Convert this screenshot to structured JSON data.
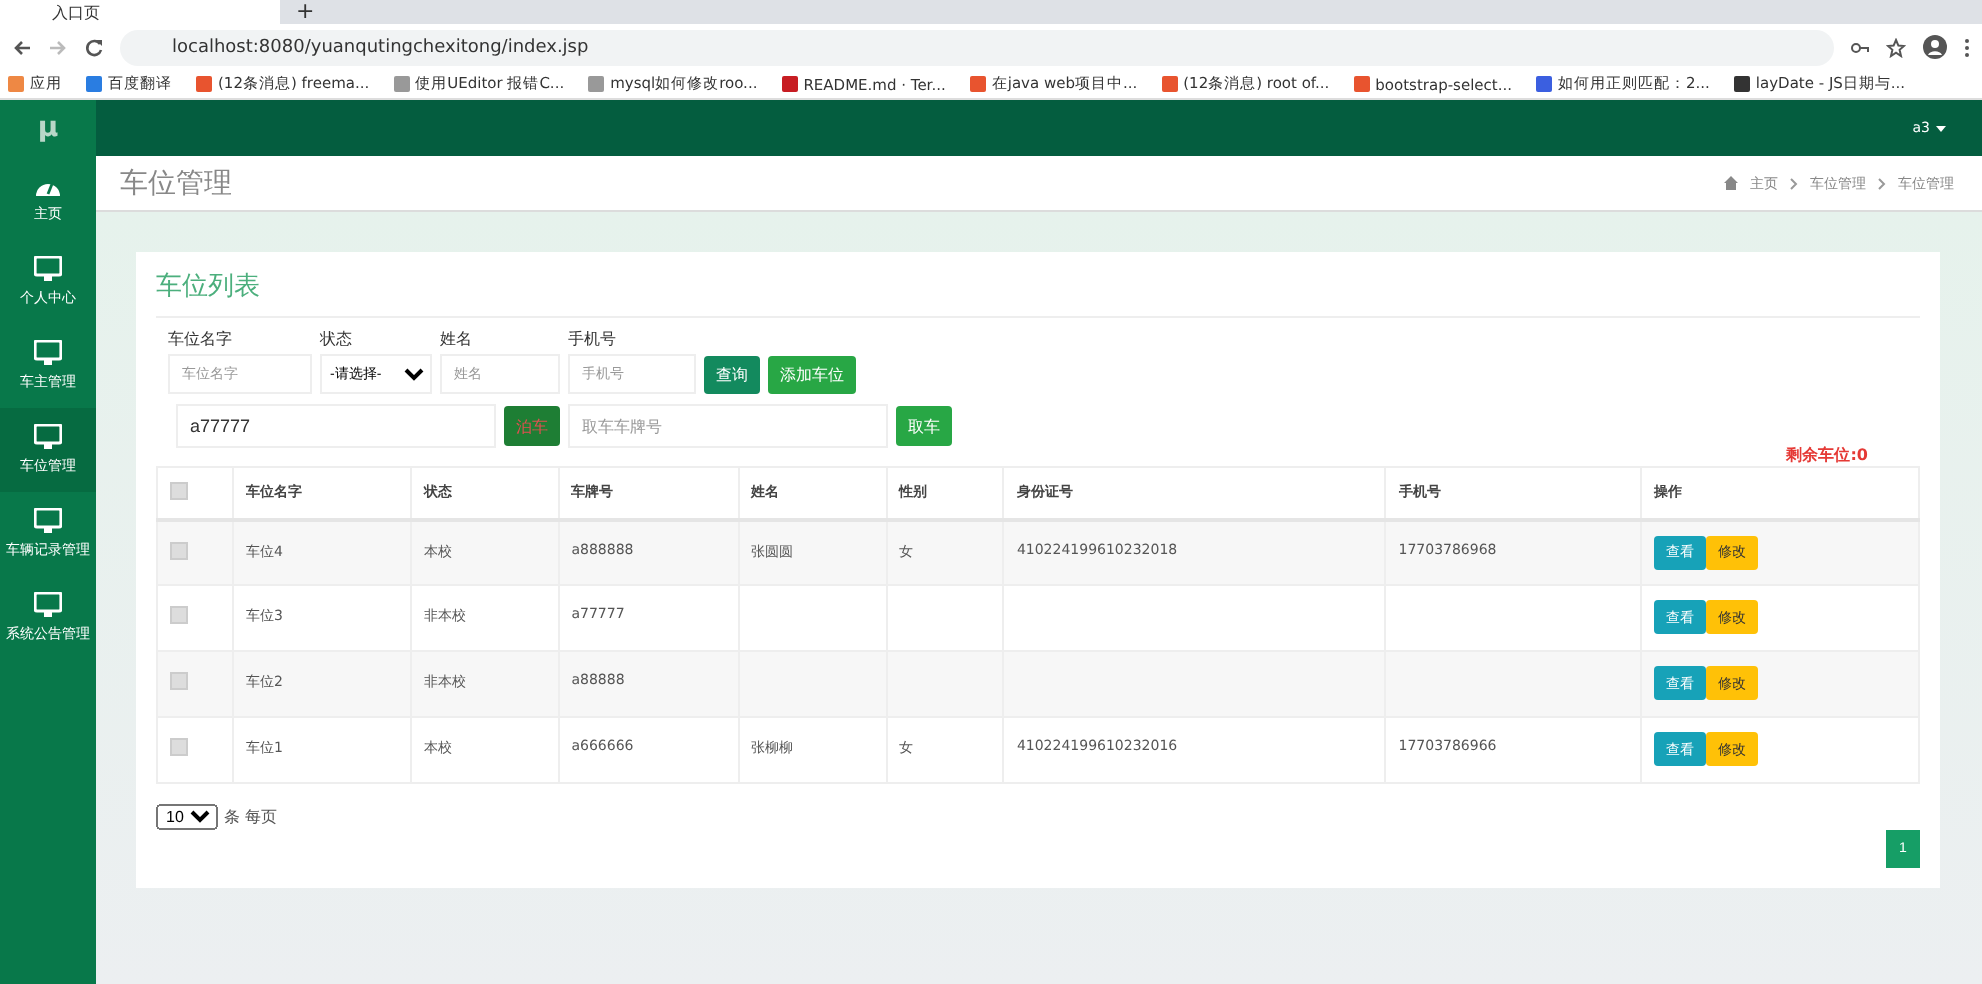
{
  "browser": {
    "tab_title": "入口页",
    "new_tab": "+",
    "url": "localhost:8080/yuanqutingchexitong/index.jsp",
    "bookmarks": [
      {
        "label": "应用",
        "kind": "apps"
      },
      {
        "label": "百度翻译",
        "kind": "blue"
      },
      {
        "label": "(12条消息) freema...",
        "kind": "csdn"
      },
      {
        "label": "使用UEditor 报错C...",
        "kind": "paw"
      },
      {
        "label": "mysql如何修改roo...",
        "kind": "paw"
      },
      {
        "label": "README.md · Ter...",
        "kind": "gitee"
      },
      {
        "label": "在java web项目中...",
        "kind": "csdn"
      },
      {
        "label": "(12条消息) root of...",
        "kind": "csdn"
      },
      {
        "label": "bootstrap-select...",
        "kind": "csdn"
      },
      {
        "label": "如何用正则匹配：2...",
        "kind": "baidu"
      },
      {
        "label": "layDate - JS日期与...",
        "kind": "dark"
      }
    ]
  },
  "app": {
    "logo": "µ",
    "user": "a3",
    "sidebar": [
      {
        "label": "主页",
        "kind": "dashboard",
        "selected": false
      },
      {
        "label": "个人中心",
        "kind": "monitor",
        "selected": false
      },
      {
        "label": "车主管理",
        "kind": "monitor",
        "selected": false
      },
      {
        "label": "车位管理",
        "kind": "monitor",
        "selected": true
      },
      {
        "label": "车辆记录管理",
        "kind": "monitor",
        "selected": false
      },
      {
        "label": "系统公告管理",
        "kind": "monitor",
        "selected": false
      }
    ],
    "page_title": "车位管理",
    "breadcrumb": [
      "主页",
      "车位管理",
      "车位管理"
    ]
  },
  "card": {
    "title": "车位列表",
    "filters": [
      {
        "label": "车位名字",
        "kind": "input",
        "placeholder": "车位名字"
      },
      {
        "label": "状态",
        "kind": "select",
        "value": "-请选择-"
      },
      {
        "label": "姓名",
        "kind": "input",
        "placeholder": "姓名"
      },
      {
        "label": "手机号",
        "kind": "input",
        "placeholder": "手机号"
      }
    ],
    "query_button": "查询",
    "add_button": "添加车位",
    "park_field": {
      "value": "a77777"
    },
    "park_button": "泊车",
    "pickup_field": {
      "placeholder": "取车车牌号"
    },
    "pickup_button": "取车",
    "remaining": "剩余车位:0",
    "table": {
      "header_checked": false,
      "columns": [
        "车位名字",
        "状态",
        "车牌号",
        "姓名",
        "性别",
        "身份证号",
        "手机号",
        "操作"
      ],
      "rows": [
        {
          "checked": false,
          "cells": [
            "车位4",
            "本校",
            "a888888",
            "张圆圆",
            "女",
            "410224199610232018",
            "17703786968"
          ],
          "actions": [
            "查看",
            "修改"
          ]
        },
        {
          "checked": false,
          "cells": [
            "车位3",
            "非本校",
            "a77777",
            "",
            "",
            "",
            ""
          ],
          "actions": [
            "查看",
            "修改"
          ]
        },
        {
          "checked": false,
          "cells": [
            "车位2",
            "非本校",
            "a88888",
            "",
            "",
            "",
            ""
          ],
          "actions": [
            "查看",
            "修改"
          ]
        },
        {
          "checked": false,
          "cells": [
            "车位1",
            "本校",
            "a666666",
            "张柳柳",
            "女",
            "410224199610232016",
            "17703786966"
          ],
          "actions": [
            "查看",
            "修改"
          ]
        }
      ]
    },
    "page_size": "10",
    "page_size_label": "条 每页",
    "pages": [
      {
        "label": "1",
        "selected": true
      }
    ]
  }
}
